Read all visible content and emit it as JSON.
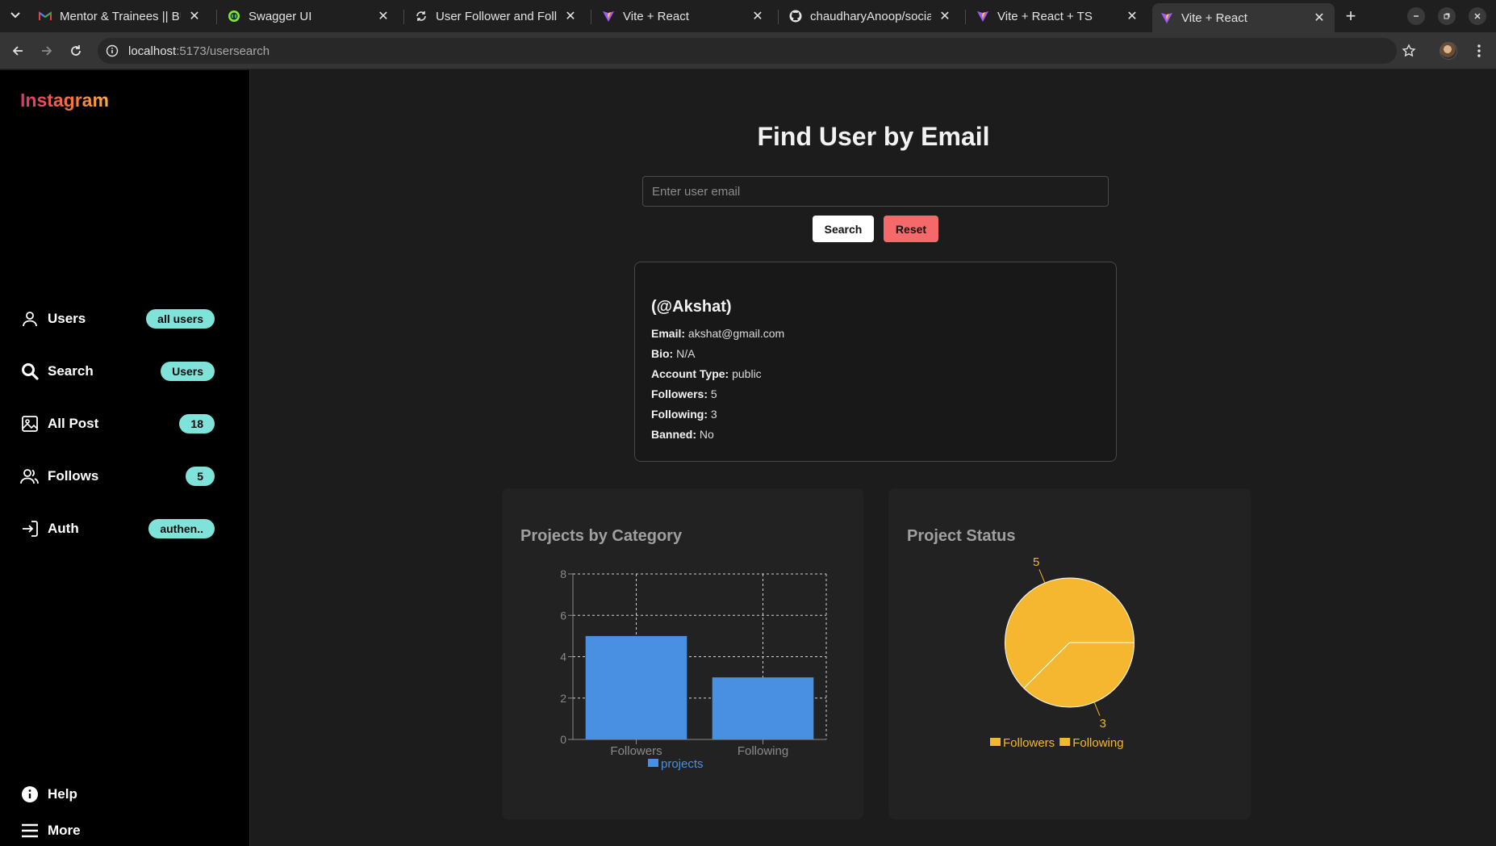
{
  "browser": {
    "tabs": [
      {
        "title": "Mentor & Trainees || BU",
        "icon": "gmail-icon",
        "active": false
      },
      {
        "title": "Swagger UI",
        "icon": "swagger-icon",
        "active": false
      },
      {
        "title": "User Follower and Follo",
        "icon": "sync-icon",
        "active": false
      },
      {
        "title": "Vite + React",
        "icon": "vite-icon",
        "active": false
      },
      {
        "title": "chaudharyAnoop/social",
        "icon": "github-icon",
        "active": false
      },
      {
        "title": "Vite + React + TS",
        "icon": "vite-icon",
        "active": false
      },
      {
        "title": "Vite + React",
        "icon": "vite-icon",
        "active": true
      }
    ],
    "url_host": "localhost",
    "url_path": ":5173/usersearch"
  },
  "sidebar": {
    "logo": "Instagram",
    "items": [
      {
        "label": "Users",
        "badge": "all users",
        "icon": "user-icon"
      },
      {
        "label": "Search",
        "badge": "Users",
        "icon": "search-icon"
      },
      {
        "label": "All Post",
        "badge": "18",
        "icon": "image-icon"
      },
      {
        "label": "Follows",
        "badge": "5",
        "icon": "users-icon"
      },
      {
        "label": "Auth",
        "badge": "authen..",
        "icon": "login-icon"
      }
    ],
    "bottom": [
      {
        "label": "Help",
        "icon": "info-icon"
      },
      {
        "label": "More",
        "icon": "menu-icon"
      }
    ]
  },
  "main": {
    "title": "Find User by Email",
    "search_placeholder": "Enter user email",
    "search_button": "Search",
    "reset_button": "Reset"
  },
  "user": {
    "handle": "(@Akshat)",
    "fields": [
      {
        "label": "Email:",
        "value": "akshat@gmail.com"
      },
      {
        "label": "Bio:",
        "value": "N/A"
      },
      {
        "label": "Account Type:",
        "value": "public"
      },
      {
        "label": "Followers:",
        "value": "5"
      },
      {
        "label": "Following:",
        "value": "3"
      },
      {
        "label": "Banned:",
        "value": "No"
      }
    ]
  },
  "colors": {
    "accent_teal": "#7fe3da",
    "bar_blue": "#4a90e2",
    "pie_yellow": "#f5b630",
    "reset_red": "#f46a6a"
  },
  "chart_data": [
    {
      "type": "bar",
      "title": "Projects by Category",
      "categories": [
        "Followers",
        "Following"
      ],
      "series": [
        {
          "name": "projects",
          "values": [
            5,
            3
          ]
        }
      ],
      "ylim": [
        0,
        8
      ],
      "yticks": [
        0,
        2,
        4,
        6,
        8
      ],
      "grid": true,
      "legend": "bottom"
    },
    {
      "type": "pie",
      "title": "Project Status",
      "labels": [
        "Followers",
        "Following"
      ],
      "values": [
        5,
        3
      ],
      "legend": "bottom"
    }
  ]
}
